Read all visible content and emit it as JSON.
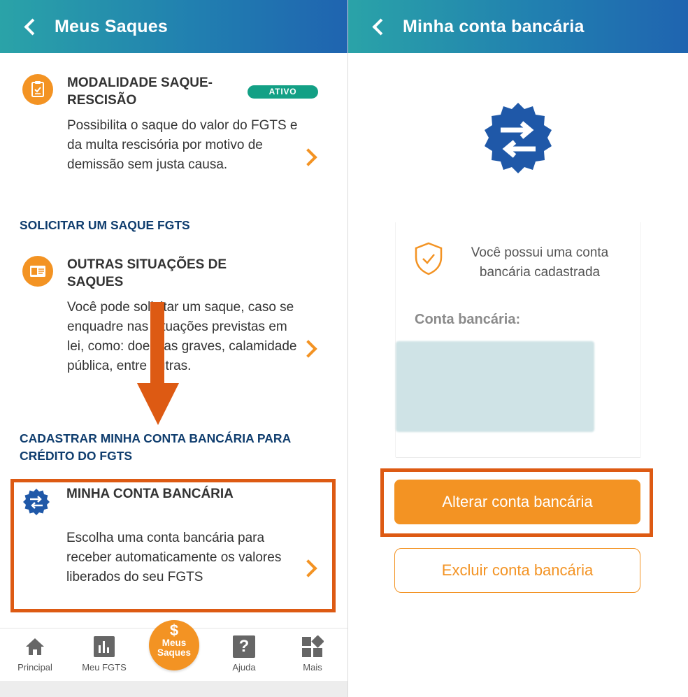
{
  "left_screen": {
    "header_title": "Meus Saques",
    "cards": [
      {
        "title": "MODALIDADE SAQUE-RESCISÃO",
        "badge": "ATIVO",
        "description": "Possibilita o saque do valor do FGTS e da multa rescisória por motivo de demissão sem justa causa."
      },
      {
        "title": "OUTRAS SITUAÇÕES DE SAQUES",
        "description": "Você pode solicitar um saque, caso se enquadre nas situações previstas em lei, como: doenças graves, calamidade pública, entre outras."
      },
      {
        "title": "MINHA CONTA BANCÁRIA",
        "description": "Escolha uma conta bancária para receber automaticamente os valores liberados do seu FGTS"
      }
    ],
    "section_titles": {
      "solicitar": "SOLICITAR UM SAQUE FGTS",
      "cadastrar": "CADASTRAR MINHA CONTA BANCÁRIA PARA CRÉDITO DO FGTS"
    },
    "bottom_nav": {
      "principal": "Principal",
      "meu_fgts": "Meu FGTS",
      "fab_symbol": "$",
      "fab_label": "Meus Saques",
      "ajuda": "Ajuda",
      "ajuda_symbol": "?",
      "mais": "Mais"
    }
  },
  "right_screen": {
    "header_title": "Minha conta bancária",
    "info_text": "Você possui uma conta bancária cadastrada",
    "account_label": "Conta bancária:",
    "account_value_masked": "",
    "primary_button": "Alterar conta bancária",
    "secondary_button": "Excluir conta bancária"
  },
  "colors": {
    "accent": "#f39323",
    "navy": "#0f3d6e",
    "badge_green": "#13a085",
    "annotation": "#dd5a13",
    "icon_blue": "#1f58a8"
  },
  "icons": {
    "back": "chevron-left-icon",
    "modalidade": "clipboard-icon",
    "outras": "id-card-icon",
    "conta": "transfer-arrows-icon",
    "home": "home-icon",
    "chart": "bar-chart-icon",
    "help": "question-icon",
    "more": "grid-icon",
    "shield": "shield-check-icon"
  }
}
